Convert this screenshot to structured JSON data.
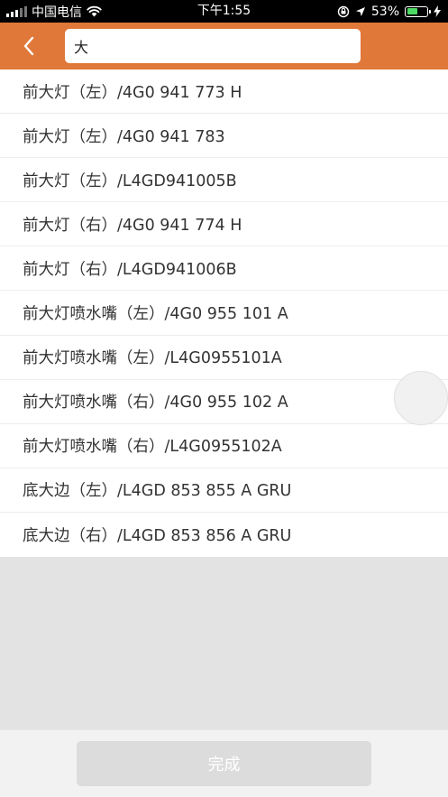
{
  "status_bar": {
    "carrier": "中国电信",
    "time": "下午1:55",
    "battery_percent": "53%",
    "battery_level": 0.53,
    "battery_color": "#4cd964"
  },
  "nav": {
    "back_icon": "chevron-left-icon",
    "search_value": "大",
    "bar_color": "#e0783a"
  },
  "results": [
    "前大灯（左）/4G0 941 773 H",
    "前大灯（左）/4G0 941 783",
    "前大灯（左）/L4GD941005B",
    "前大灯（右）/4G0 941 774 H",
    "前大灯（右）/L4GD941006B",
    "前大灯喷水嘴（左）/4G0 955 101 A",
    "前大灯喷水嘴（左）/L4G0955101A",
    "前大灯喷水嘴（右）/4G0 955 102 A",
    "前大灯喷水嘴（右）/L4G0955102A",
    "底大边（左）/L4GD 853 855 A GRU",
    "底大边（右）/L4GD 853 856 A GRU"
  ],
  "footer": {
    "done_label": "完成"
  }
}
